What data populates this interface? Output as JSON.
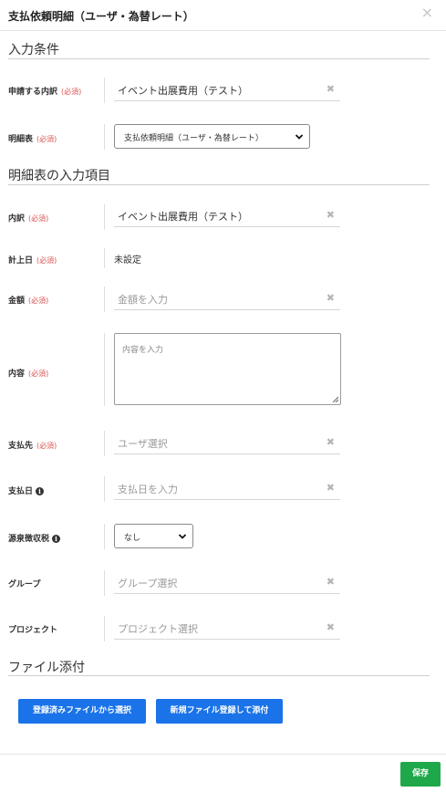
{
  "modal": {
    "title": "支払依頼明細（ユーザ・為替レート）",
    "close": "×"
  },
  "required_mark": "(必須)",
  "section_input": {
    "title": "入力条件",
    "apply_item": {
      "label": "申請する内訳",
      "value": "イベント出展費用（テスト）"
    },
    "statement": {
      "label": "明細表",
      "value": "支払依頼明細（ユーザ・為替レート）"
    }
  },
  "section_fields": {
    "title": "明細表の入力項目",
    "breakdown": {
      "label": "内訳",
      "value": "イベント出展費用（テスト）"
    },
    "record_date": {
      "label": "計上日",
      "value": "未設定"
    },
    "amount": {
      "label": "金額",
      "placeholder": "金額を入力"
    },
    "content": {
      "label": "内容",
      "placeholder": "内容を入力"
    },
    "payee": {
      "label": "支払先",
      "placeholder": "ユーザ選択"
    },
    "pay_date": {
      "label": "支払日",
      "placeholder": "支払日を入力"
    },
    "withholding": {
      "label": "源泉徴収税",
      "value": "なし"
    },
    "group": {
      "label": "グループ",
      "placeholder": "グループ選択"
    },
    "project": {
      "label": "プロジェクト",
      "placeholder": "プロジェクト選択"
    }
  },
  "section_attach": {
    "title": "ファイル添付",
    "select_existing": "登録済みファイルから選択",
    "register_new": "新規ファイル登録して添付"
  },
  "footer": {
    "save": "保存"
  },
  "icons": {
    "clear": "clear-x-icon",
    "dropdown": "chevron-down-icon",
    "info": "info-circle-icon",
    "close": "close-icon"
  },
  "colors": {
    "primary": "#1a73e8",
    "save": "#1fa84a",
    "required": "#d9534f"
  }
}
